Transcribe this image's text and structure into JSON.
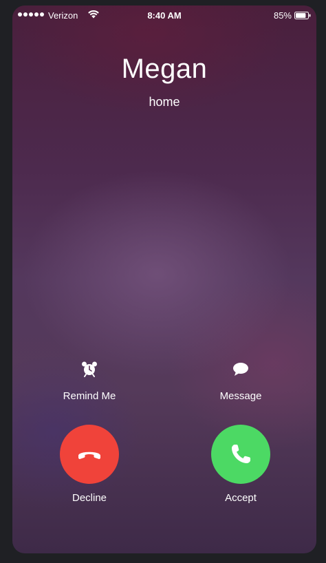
{
  "status_bar": {
    "carrier": "Verizon",
    "time": "8:40 AM",
    "battery": "85%",
    "signal_icon": "signal-dots-icon",
    "wifi_icon": "wifi-icon",
    "battery_icon": "battery-icon",
    "battery_level": 0.85
  },
  "caller": {
    "name": "Megan",
    "label": "home"
  },
  "actions": {
    "remind": {
      "label": "Remind Me",
      "icon": "alarm-clock-icon"
    },
    "message": {
      "label": "Message",
      "icon": "speech-bubble-icon"
    },
    "decline": {
      "label": "Decline",
      "icon": "hang-up-icon",
      "color": "#f0433a"
    },
    "accept": {
      "label": "Accept",
      "icon": "phone-icon",
      "color": "#4cd964"
    }
  }
}
